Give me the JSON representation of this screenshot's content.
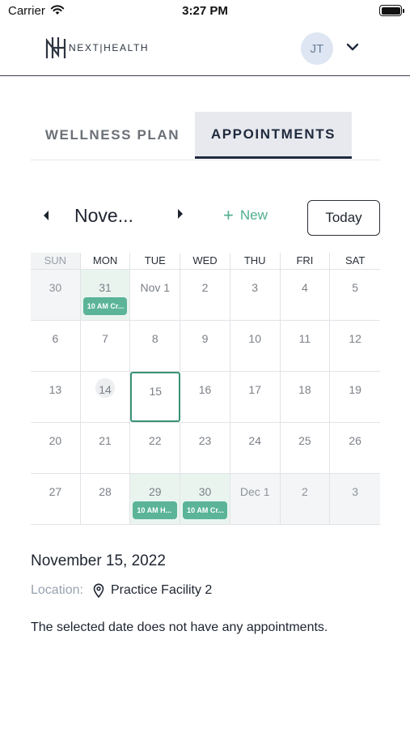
{
  "status_bar": {
    "carrier": "Carrier",
    "time": "3:27 PM"
  },
  "header": {
    "logo_text": "NEXT|HEALTH",
    "avatar_initials": "JT"
  },
  "tabs": [
    {
      "label": "WELLNESS PLAN",
      "active": false
    },
    {
      "label": "APPOINTMENTS",
      "active": true
    }
  ],
  "calendar": {
    "month_label": "Nove...",
    "new_label": "New",
    "today_label": "Today",
    "weekdays": [
      "SUN",
      "MON",
      "TUE",
      "WED",
      "THU",
      "FRI",
      "SAT"
    ],
    "weeks": [
      [
        {
          "label": "30",
          "state": "shaded"
        },
        {
          "label": "31",
          "state": "green",
          "event": "10 AM Cr..."
        },
        {
          "label": "Nov 1"
        },
        {
          "label": "2"
        },
        {
          "label": "3"
        },
        {
          "label": "4"
        },
        {
          "label": "5"
        }
      ],
      [
        {
          "label": "6"
        },
        {
          "label": "7"
        },
        {
          "label": "8"
        },
        {
          "label": "9"
        },
        {
          "label": "10"
        },
        {
          "label": "11"
        },
        {
          "label": "12"
        }
      ],
      [
        {
          "label": "13"
        },
        {
          "label": "14",
          "state": "today"
        },
        {
          "label": "15",
          "state": "selected"
        },
        {
          "label": "16"
        },
        {
          "label": "17"
        },
        {
          "label": "18"
        },
        {
          "label": "19"
        }
      ],
      [
        {
          "label": "20"
        },
        {
          "label": "21"
        },
        {
          "label": "22"
        },
        {
          "label": "23"
        },
        {
          "label": "24"
        },
        {
          "label": "25"
        },
        {
          "label": "26"
        }
      ],
      [
        {
          "label": "27"
        },
        {
          "label": "28"
        },
        {
          "label": "29",
          "state": "green",
          "event": "10 AM H..."
        },
        {
          "label": "30",
          "state": "green",
          "event": "10 AM Cr..."
        },
        {
          "label": "Dec 1",
          "state": "shaded"
        },
        {
          "label": "2",
          "state": "shaded"
        },
        {
          "label": "3",
          "state": "shaded"
        }
      ]
    ]
  },
  "details": {
    "selected_date": "November 15, 2022",
    "location_label": "Location:",
    "location_value": "Practice Facility 2",
    "empty_message": "The selected date does not have any appointments."
  },
  "colors": {
    "accent_green": "#5bb498",
    "tab_active_bg": "#e7e9ee",
    "navy": "#1f2a3d"
  }
}
